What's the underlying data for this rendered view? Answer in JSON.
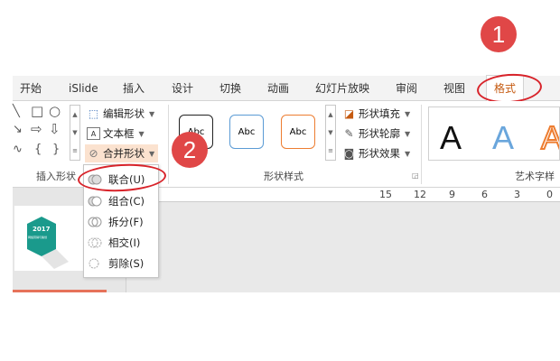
{
  "tabs": [
    {
      "label": "开始"
    },
    {
      "label": "iSlide"
    },
    {
      "label": "插入"
    },
    {
      "label": "设计"
    },
    {
      "label": "切换"
    },
    {
      "label": "动画"
    },
    {
      "label": "幻灯片放映"
    },
    {
      "label": "审阅"
    },
    {
      "label": "视图"
    },
    {
      "label": "格式",
      "active": true
    }
  ],
  "ribbon": {
    "insert_shapes": {
      "label": "插入形状",
      "edit_shape": "编辑形状",
      "text_box": "文本框",
      "merge_shapes": "合并形状"
    },
    "shape_styles": {
      "label": "形状样式",
      "presets": [
        {
          "text": "Abc",
          "border": "#222222"
        },
        {
          "text": "Abc",
          "border": "#5b9bd5"
        },
        {
          "text": "Abc",
          "border": "#ed7d31"
        }
      ],
      "fill": "形状填充",
      "outline": "形状轮廓",
      "effects": "形状效果"
    },
    "wordart": {
      "label": "艺术字样",
      "samples": [
        {
          "text": "A",
          "color": "#111111"
        },
        {
          "text": "A",
          "color": "#5b9bd5"
        },
        {
          "text": "A",
          "color": "#ed7d31"
        }
      ]
    }
  },
  "ruler": {
    "ticks": [
      "15",
      "12",
      "9",
      "6",
      "3",
      "0"
    ]
  },
  "slide_thumb": {
    "year": "2017",
    "subtitle": "网络营销与策划"
  },
  "dropdown": {
    "items": [
      {
        "label": "联合(U)",
        "enabled": true
      },
      {
        "label": "组合(C)",
        "enabled": true
      },
      {
        "label": "拆分(F)",
        "enabled": true
      },
      {
        "label": "相交(I)",
        "enabled": true
      },
      {
        "label": "剪除(S)",
        "enabled": true
      }
    ]
  },
  "badges": {
    "step1": "1",
    "step2": "2"
  },
  "colors": {
    "accent": "#c55a11",
    "annotation": "#e04747",
    "teal": "#1a9a8c"
  }
}
